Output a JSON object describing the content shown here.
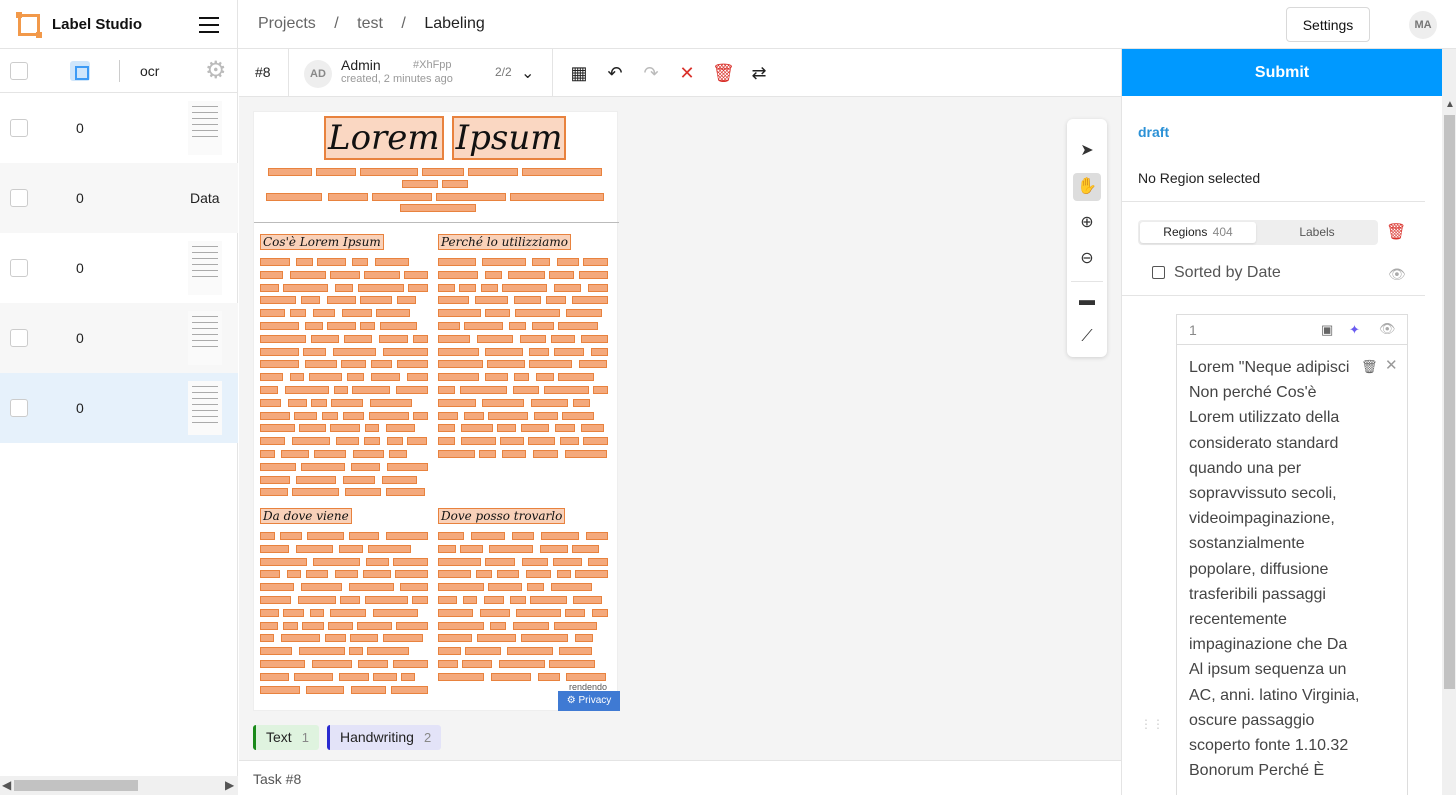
{
  "app": {
    "name": "Label Studio"
  },
  "breadcrumb": {
    "items": [
      "Projects",
      "test",
      "Labeling"
    ],
    "separator": "/"
  },
  "header": {
    "settings_label": "Settings",
    "user_initials": "MA"
  },
  "task_list": {
    "column_label": "ocr",
    "rows": [
      {
        "count": "0",
        "preview": "thumbnail",
        "selected": false
      },
      {
        "count": "0",
        "preview": "Data",
        "selected": false
      },
      {
        "count": "0",
        "preview": "thumbnail",
        "selected": false
      },
      {
        "count": "0",
        "preview": "thumbnail",
        "selected": false
      },
      {
        "count": "0",
        "preview": "thumbnail",
        "selected": true
      }
    ]
  },
  "toolbar": {
    "task_id": "#8",
    "annotator_initials": "AD",
    "annotator_name": "Admin",
    "annotation_hash": "#XhFpp",
    "annotation_created": "created, 2 minutes ago",
    "annotation_count": "2/2"
  },
  "document": {
    "title_words": [
      "Lorem",
      "Ipsum"
    ],
    "headings": [
      "Cos'è Lorem Ipsum",
      "Perché lo utilizziamo",
      "Da dove viene",
      "Dove posso trovarlo"
    ],
    "rendendo": "rendendo",
    "privacy_label": "Privacy"
  },
  "labels": [
    {
      "name": "Text",
      "count": "1",
      "color": "#1a8a1a",
      "bg": "#dff3df"
    },
    {
      "name": "Handwriting",
      "count": "2",
      "color": "#2a2ad0",
      "bg": "#e3e3f8"
    }
  ],
  "footer": {
    "task_label": "Task #8"
  },
  "right": {
    "submit_label": "Submit",
    "status": "draft",
    "no_region": "No Region selected",
    "tabs": {
      "regions_label": "Regions",
      "regions_count": "404",
      "labels_label": "Labels"
    },
    "sort_label": "Sorted by Date",
    "region": {
      "index": "1",
      "text": "Lorem \"Neque adipisci Non perché Cos'è Lorem utilizzato della considerato standard quando una per sopravvissuto secoli, videoimpaginazione, sostanzialmente popolare, diffusione trasferibili passaggi recentemente impaginazione che Da Al ipsum sequenza un AC, anni. latino Virginia, oscure passaggio scoperto fonte 1.10.32 Bonorum Perché È"
    }
  },
  "colors": {
    "accent": "#0099ff",
    "region": "#e8823e",
    "draft": "#2b91d6",
    "danger": "#d9312b"
  }
}
